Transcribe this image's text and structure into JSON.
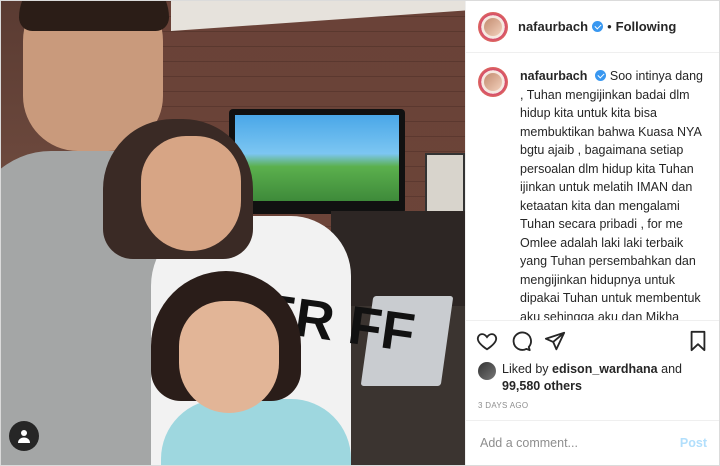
{
  "post": {
    "username": "nafaurbach",
    "dot": "•",
    "follow_label": "Following",
    "caption": "Soo intinya dang , Tuhan mengijinkan badai dlm hidup kita untuk kita bisa membuktikan bahwa Kuasa NYA bgtu ajaib , bagaimana setiap persoalan dlm hidup kita Tuhan ijinkan untuk melatih IMAN dan ketaatan kita dan mengalami Tuhan secara pribadi , for me Omlee adalah laki laki terbaik yang Tuhan persembahkan dan mengijinkan hidupnya untuk dipakai Tuhan untuk membentuk aku sehingga aku dan Mikha mengalami Tuhan dan mengerti bahwaaa tanpa TUhan kami bukanlah siapa siapa dan tidak bisa melakukan apa apaa . And yesss Tuhan belum selesai membentuk kamiii , entah sampe",
    "likes_prefix": "Liked by",
    "liked_by_user": "edison_wardhana",
    "likes_and": "and",
    "likes_count": "99,580 others",
    "date": "3 DAYS AGO",
    "comment_placeholder": "Add a comment...",
    "post_button": "Post",
    "shirt_print": "ER FF"
  },
  "icons": {
    "like": "heart-icon",
    "comment": "comment-icon",
    "share": "share-icon",
    "save": "bookmark-icon",
    "tag": "user-tag-icon"
  },
  "colors": {
    "verified": "#3897f0",
    "post_disabled": "#b2dffc",
    "meta": "#8e8e8e"
  }
}
